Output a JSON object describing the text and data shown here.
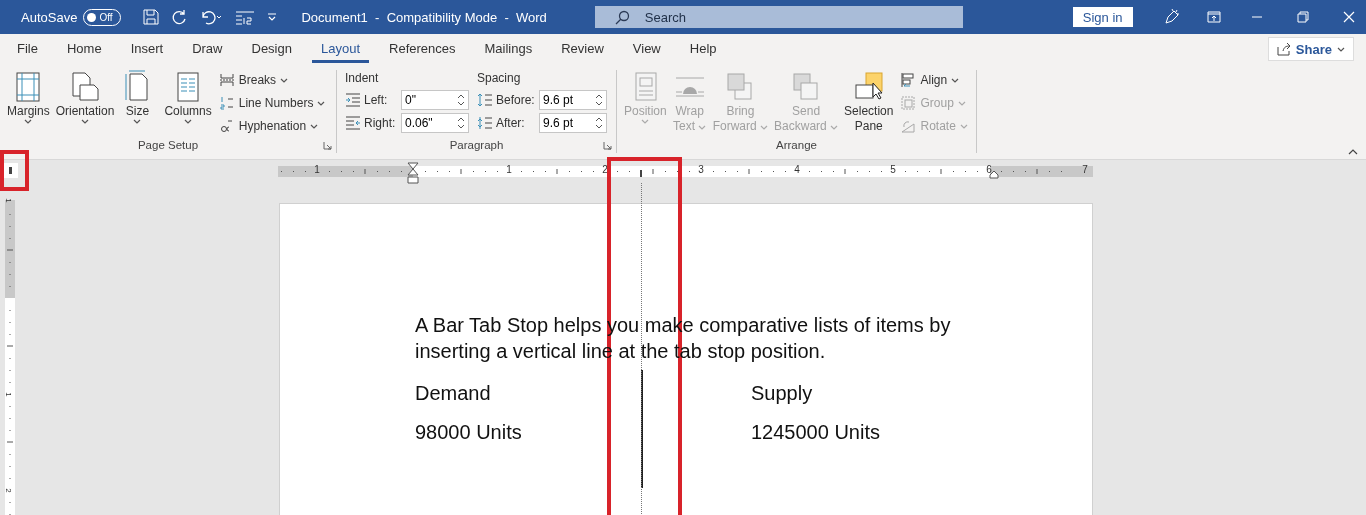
{
  "title_bar": {
    "autosave_label": "AutoSave",
    "autosave_toggle": {
      "label": "Off",
      "on": false
    },
    "title": "Document1  -  Compatibility Mode  -  Word",
    "search": {
      "placeholder": "Search"
    },
    "sign_in": "Sign in"
  },
  "tabs": [
    {
      "label": "File",
      "selected": false
    },
    {
      "label": "Home",
      "selected": false
    },
    {
      "label": "Insert",
      "selected": false
    },
    {
      "label": "Draw",
      "selected": false
    },
    {
      "label": "Design",
      "selected": false
    },
    {
      "label": "Layout",
      "selected": true
    },
    {
      "label": "References",
      "selected": false
    },
    {
      "label": "Mailings",
      "selected": false
    },
    {
      "label": "Review",
      "selected": false
    },
    {
      "label": "View",
      "selected": false
    },
    {
      "label": "Help",
      "selected": false
    }
  ],
  "share": "Share",
  "page_setup": {
    "name": "Page Setup",
    "big": [
      {
        "kind": "margins",
        "lines": [
          "Margins"
        ]
      },
      {
        "kind": "orientation",
        "lines": [
          "Orientation"
        ]
      },
      {
        "kind": "size",
        "lines": [
          "Size"
        ]
      },
      {
        "kind": "columns",
        "lines": [
          "Columns"
        ]
      }
    ],
    "small": [
      {
        "kind": "breaks",
        "label": "Breaks"
      },
      {
        "kind": "line_numbers",
        "label": "Line Numbers"
      },
      {
        "kind": "hyphenation",
        "label": "Hyphenation"
      }
    ]
  },
  "paragraph": {
    "name": "Paragraph",
    "indent": {
      "heading": "Indent",
      "fields": [
        {
          "kind": "left",
          "label": "Left:",
          "value": "0\""
        },
        {
          "kind": "right",
          "label": "Right:",
          "value": "0.06\""
        }
      ]
    },
    "spacing": {
      "heading": "Spacing",
      "fields": [
        {
          "kind": "before",
          "label": "Before:",
          "value": "9.6 pt"
        },
        {
          "kind": "after",
          "label": "After:",
          "value": "9.6 pt"
        }
      ]
    }
  },
  "arrange": {
    "name": "Arrange",
    "big": [
      {
        "kind": "position",
        "lines": [
          "Position"
        ],
        "caret": true,
        "caret_below": true,
        "disabled": true
      },
      {
        "kind": "wrap",
        "lines": [
          "Wrap",
          "Text"
        ],
        "caret": true,
        "caret_below": false,
        "disabled": true
      },
      {
        "kind": "forward",
        "lines": [
          "Bring",
          "Forward"
        ],
        "caret": true,
        "caret_below": false,
        "disabled": true
      },
      {
        "kind": "backward",
        "lines": [
          "Send",
          "Backward"
        ],
        "caret": true,
        "caret_below": false,
        "disabled": true
      },
      {
        "kind": "selection",
        "lines": [
          "Selection",
          "Pane"
        ],
        "caret": false,
        "disabled": false
      }
    ],
    "small": [
      {
        "kind": "align",
        "label": "Align",
        "disabled": false
      },
      {
        "kind": "group",
        "label": "Group",
        "disabled": true
      },
      {
        "kind": "rotate",
        "label": "Rotate",
        "disabled": true
      }
    ]
  },
  "ruler": {
    "labels": [
      "1",
      "1",
      "2",
      "3",
      "4",
      "5",
      "6",
      "7"
    ]
  },
  "vertical_ruler": {
    "labels": [
      "1",
      "1",
      "2"
    ]
  },
  "document": {
    "paragraph": "A Bar Tab Stop helps you make comparative lists of items by inserting a vertical line at the tab stop position.",
    "rows": [
      {
        "left": "Demand",
        "right": "Supply"
      },
      {
        "left": "98000 Units",
        "right": "1245000 Units"
      }
    ]
  }
}
